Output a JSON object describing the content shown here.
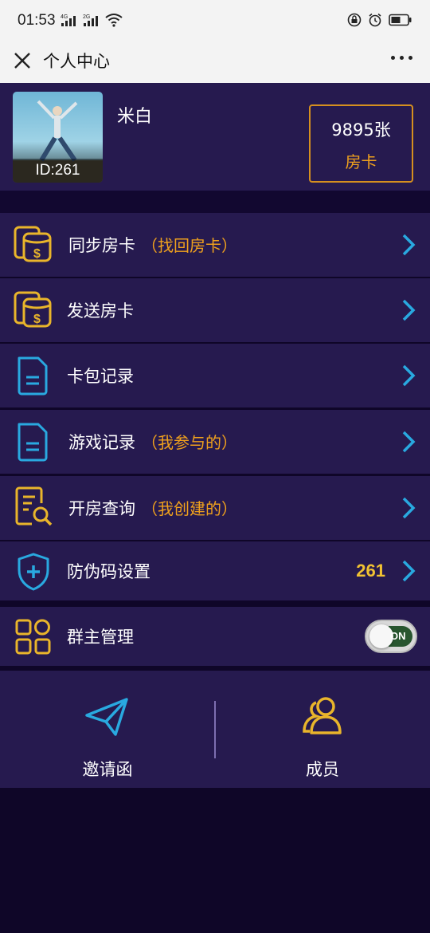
{
  "status_bar": {
    "time": "01:53",
    "network_1": "4G",
    "network_2": "2G"
  },
  "title_bar": {
    "title": "个人中心"
  },
  "profile": {
    "username": "米白",
    "id_label": "ID:261",
    "card_count": "9895张",
    "card_label": "房卡"
  },
  "menu": [
    {
      "label": "同步房卡",
      "sub": "（找回房卡）",
      "icon": "money-bag-icon"
    },
    {
      "label": "发送房卡",
      "sub": "",
      "icon": "money-bag-icon"
    },
    {
      "label": "卡包记录",
      "sub": "",
      "icon": "document-icon"
    },
    {
      "label": "游戏记录",
      "sub": "（我参与的）",
      "icon": "document-icon"
    },
    {
      "label": "开房查询",
      "sub": "（我创建的）",
      "icon": "search-document-icon"
    },
    {
      "label": "防伪码设置",
      "value": "261",
      "icon": "shield-plus-icon"
    },
    {
      "label": "群主管理",
      "toggle": "ON",
      "icon": "grid-icon"
    }
  ],
  "bottom": {
    "invite_label": "邀请函",
    "members_label": "成员"
  },
  "colors": {
    "panel": "#261a4f",
    "background": "#0f0628",
    "accent_orange": "#f0a11d",
    "accent_blue": "#29a9e0",
    "value_yellow": "#f1c232"
  }
}
